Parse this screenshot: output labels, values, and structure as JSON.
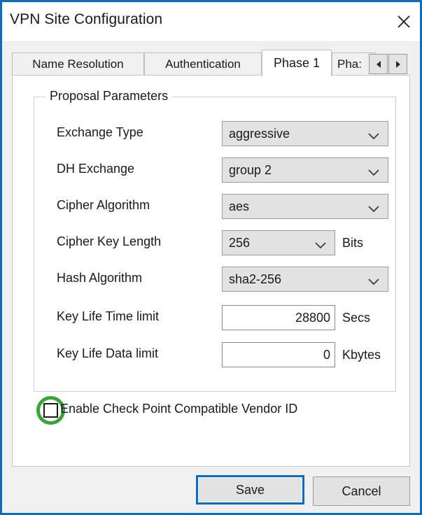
{
  "window": {
    "title": "VPN Site Configuration",
    "close_icon": "close-x-icon",
    "accent_color": "#0a6cc4"
  },
  "tabs": [
    {
      "label": "Name Resolution",
      "active": false
    },
    {
      "label": "Authentication",
      "active": false
    },
    {
      "label": "Phase 1",
      "active": true
    },
    {
      "label": "Pha:",
      "active": false
    }
  ],
  "tab_scroll": {
    "left_icon": "arrow-left-icon",
    "right_icon": "arrow-right-icon"
  },
  "groupbox": {
    "title": "Proposal Parameters"
  },
  "fields": {
    "exchange_type": {
      "label": "Exchange Type",
      "value": "aggressive",
      "control": "dropdown",
      "chevron_icon": "chevron-down-icon"
    },
    "dh_exchange": {
      "label": "DH Exchange",
      "value": "group 2",
      "control": "dropdown",
      "chevron_icon": "chevron-down-icon"
    },
    "cipher_algorithm": {
      "label": "Cipher Algorithm",
      "value": "aes",
      "control": "dropdown",
      "chevron_icon": "chevron-down-icon"
    },
    "cipher_key_length": {
      "label": "Cipher Key Length",
      "value": "256",
      "unit": "Bits",
      "control": "dropdown",
      "chevron_icon": "chevron-down-icon"
    },
    "hash_algorithm": {
      "label": "Hash Algorithm",
      "value": "sha2-256",
      "control": "dropdown",
      "chevron_icon": "chevron-down-icon"
    },
    "key_life_time_limit": {
      "label": "Key Life Time limit",
      "value": "28800",
      "unit": "Secs",
      "control": "textbox"
    },
    "key_life_data_limit": {
      "label": "Key Life Data limit",
      "value": "0",
      "unit": "Kbytes",
      "control": "textbox"
    }
  },
  "checkbox": {
    "label": "Enable Check Point Compatible Vendor ID",
    "checked": false,
    "highlight_color": "#3aa33a"
  },
  "footer": {
    "save_label": "Save",
    "cancel_label": "Cancel"
  }
}
